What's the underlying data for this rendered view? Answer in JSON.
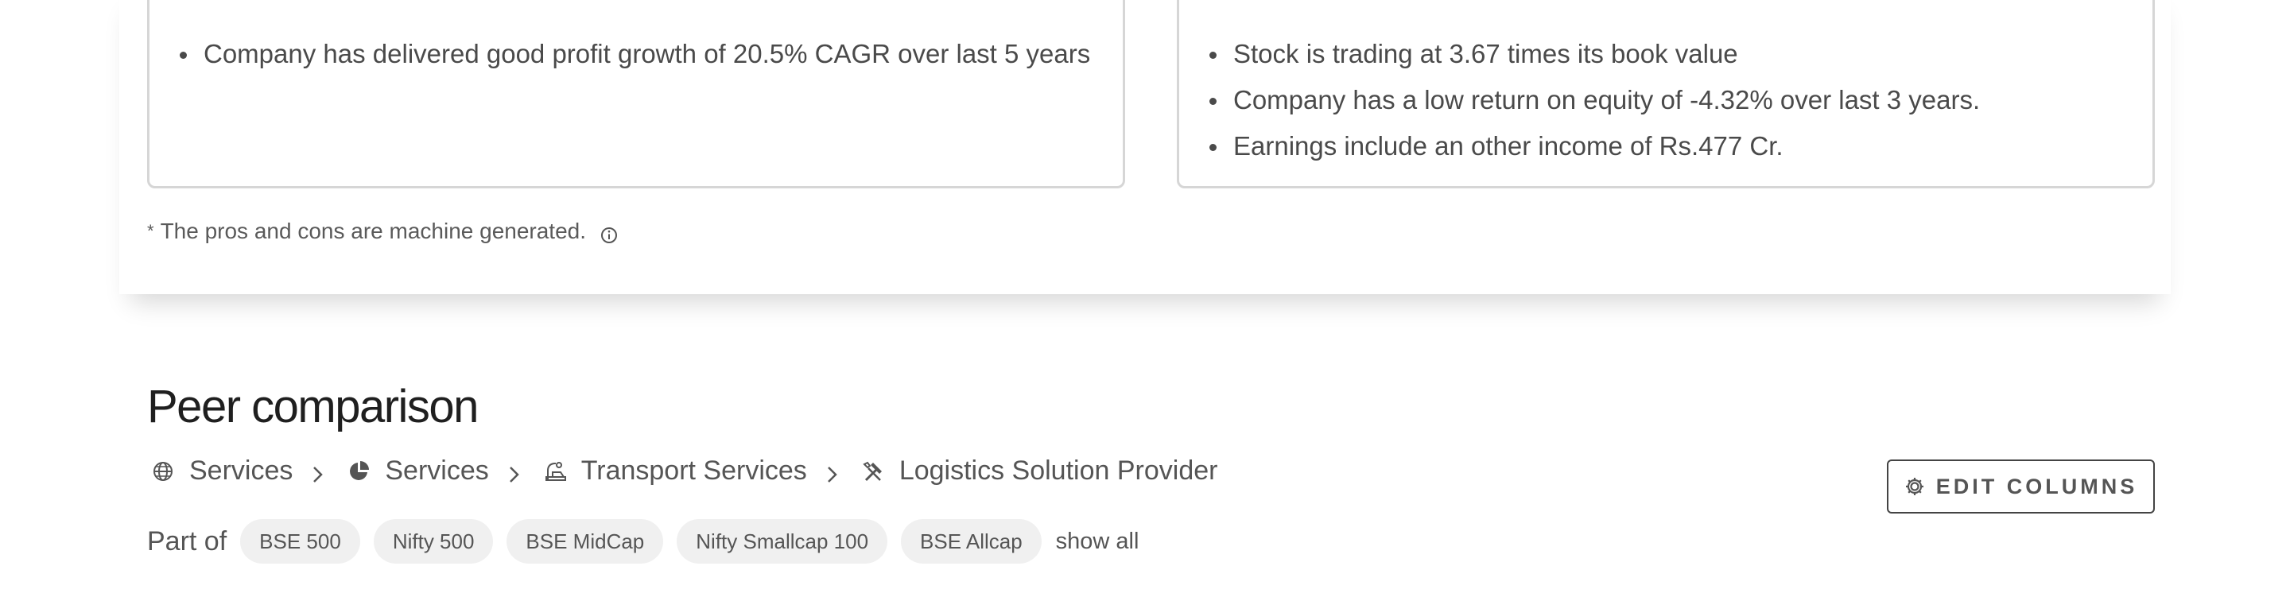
{
  "pros": {
    "items": [
      "Company has delivered good profit growth of 20.5% CAGR over last 5 years"
    ]
  },
  "cons": {
    "items": [
      "Stock is trading at 3.67 times its book value",
      "Company has a low return on equity of -4.32% over last 3 years.",
      "Earnings include an other income of Rs.477 Cr."
    ]
  },
  "disclaimer": {
    "asterisk": "*",
    "text": "The pros and cons are machine generated.",
    "icon": "info-icon"
  },
  "peer": {
    "title": "Peer comparison",
    "breadcrumb": [
      {
        "icon": "globe-icon",
        "label": "Services"
      },
      {
        "icon": "pie-chart-icon",
        "label": "Services"
      },
      {
        "icon": "truck-icon",
        "label": "Transport Services"
      },
      {
        "icon": "tools-icon",
        "label": "Logistics Solution Provider"
      }
    ],
    "edit_columns_label": "EDIT COLUMNS",
    "part_of_label": "Part of",
    "indices": [
      "BSE 500",
      "Nifty 500",
      "BSE MidCap",
      "Nifty Smallcap 100",
      "BSE Allcap"
    ],
    "show_all_label": "show all"
  }
}
